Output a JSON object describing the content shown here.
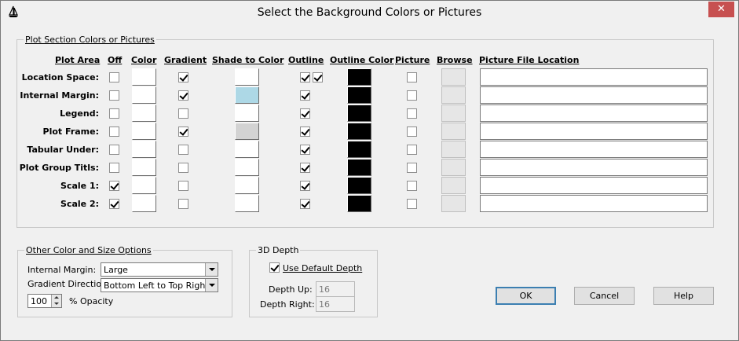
{
  "window": {
    "title": "Select the Background Colors or Pictures",
    "close_glyph": "✕"
  },
  "plot_section": {
    "label": "Plot Section Colors or Pictures",
    "columns": {
      "plot_area": "Plot Area",
      "off": "Off",
      "color": "Color",
      "gradient": "Gradient",
      "shade": "Shade to Color",
      "outline": "Outline",
      "outline_color": "Outline Color",
      "picture": "Picture",
      "browse": "Browse",
      "location": "Picture File Location"
    },
    "rows": [
      {
        "label": "Location Space:",
        "off": false,
        "color": "#ffffff",
        "gradient": true,
        "shade": "#ffffff",
        "outline": true,
        "outline_extra": true,
        "outline_color": "#000000",
        "picture": false,
        "location": ""
      },
      {
        "label": "Internal Margin:",
        "off": false,
        "color": "#ffffff",
        "gradient": true,
        "shade": "#add8e6",
        "outline": true,
        "outline_extra": false,
        "outline_color": "#000000",
        "picture": false,
        "location": ""
      },
      {
        "label": "Legend:",
        "off": false,
        "color": "#ffffff",
        "gradient": false,
        "shade": "#ffffff",
        "outline": true,
        "outline_extra": false,
        "outline_color": "#000000",
        "picture": false,
        "location": ""
      },
      {
        "label": "Plot Frame:",
        "off": false,
        "color": "#ffffff",
        "gradient": true,
        "shade": "#d3d3d3",
        "outline": true,
        "outline_extra": false,
        "outline_color": "#000000",
        "picture": false,
        "location": ""
      },
      {
        "label": "Tabular Under:",
        "off": false,
        "color": "#ffffff",
        "gradient": false,
        "shade": "#ffffff",
        "outline": true,
        "outline_extra": false,
        "outline_color": "#000000",
        "picture": false,
        "location": ""
      },
      {
        "label": "Plot Group Titls:",
        "off": false,
        "color": "#ffffff",
        "gradient": false,
        "shade": "#ffffff",
        "outline": true,
        "outline_extra": false,
        "outline_color": "#000000",
        "picture": false,
        "location": ""
      },
      {
        "label": "Scale 1:",
        "off": true,
        "color": "#ffffff",
        "gradient": false,
        "shade": "#ffffff",
        "outline": true,
        "outline_extra": false,
        "outline_color": "#000000",
        "picture": false,
        "location": ""
      },
      {
        "label": "Scale 2:",
        "off": true,
        "color": "#ffffff",
        "gradient": false,
        "shade": "#ffffff",
        "outline": true,
        "outline_extra": false,
        "outline_color": "#000000",
        "picture": false,
        "location": ""
      }
    ]
  },
  "other_options": {
    "label": "Other Color and Size Options",
    "internal_margin_label": "Internal Margin:",
    "internal_margin_value": "Large",
    "gradient_direction_label": "Gradient Direction:",
    "gradient_direction_value": "Bottom Left to Top Right",
    "opacity_value": "100",
    "opacity_label": "% Opacity"
  },
  "depth": {
    "label": "3D Depth",
    "use_default_label": "Use Default Depth",
    "use_default_checked": true,
    "depth_up_label": "Depth Up:",
    "depth_up_value": "16",
    "depth_right_label": "Depth Right:",
    "depth_right_value": "16"
  },
  "buttons": {
    "ok": "OK",
    "cancel": "Cancel",
    "help": "Help"
  },
  "icons": {
    "app": "sailboat-icon",
    "close": "close-icon"
  }
}
